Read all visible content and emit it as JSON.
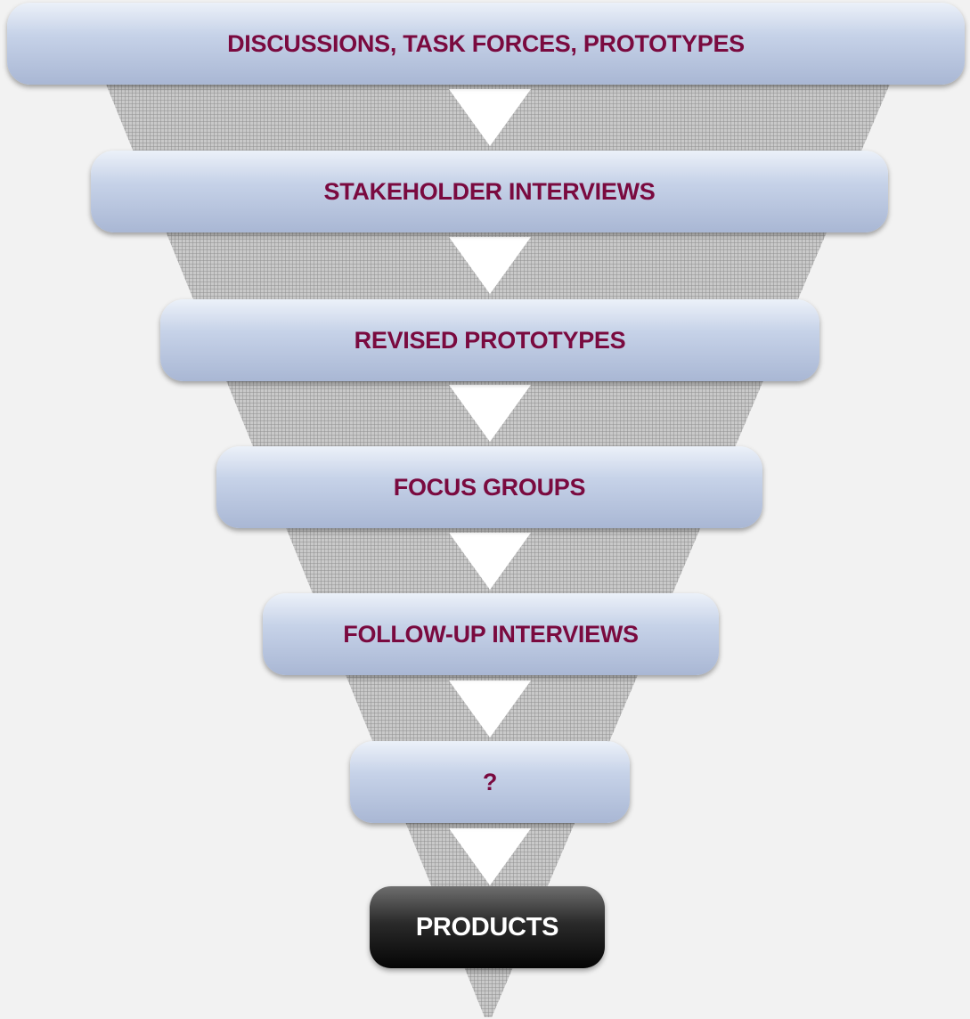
{
  "stages": [
    {
      "label": "DISCUSSIONS, TASK FORCES, PROTOTYPES"
    },
    {
      "label": "STAKEHOLDER INTERVIEWS"
    },
    {
      "label": "REVISED PROTOTYPES"
    },
    {
      "label": "FOCUS GROUPS"
    },
    {
      "label": "FOLLOW-UP INTERVIEWS"
    },
    {
      "label": "?"
    },
    {
      "label": "PRODUCTS"
    }
  ],
  "colors": {
    "background": "#f2f2f2",
    "stage_text": "#7a0a3f",
    "final_stage_fill": "#111111",
    "final_stage_text": "#ffffff",
    "funnel_hatch": "#9a9a9a",
    "arrow": "#ffffff"
  }
}
